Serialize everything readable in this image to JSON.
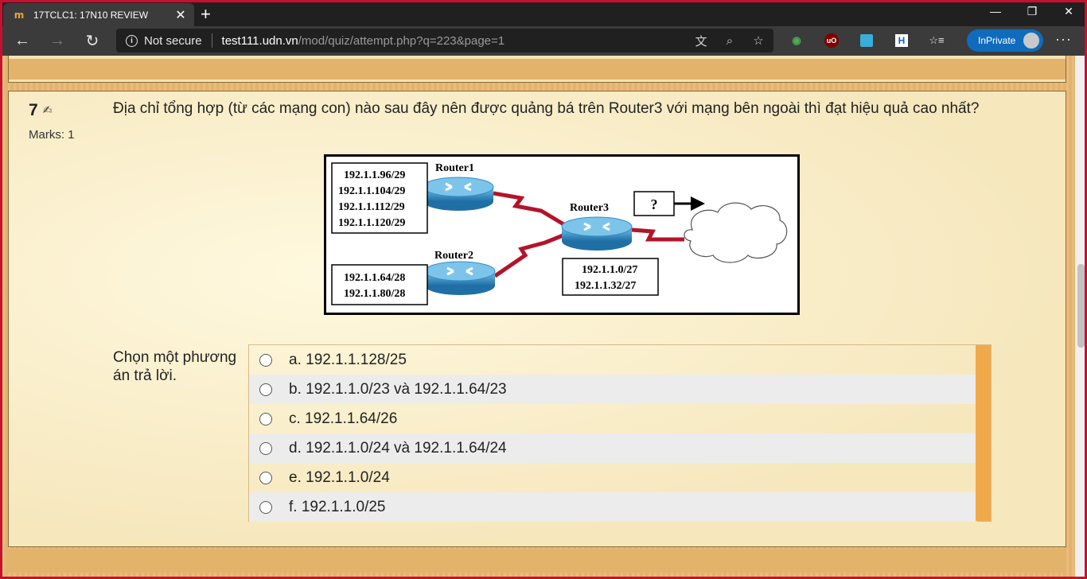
{
  "browser": {
    "tab_title": "17TCLC1: 17N10 REVIEW",
    "tab_favicon": "m",
    "not_secure": "Not secure",
    "url_host": "test111.udn.vn",
    "url_path": "/mod/quiz/attempt.php?q=223&page=1",
    "inprivate_label": "InPrivate"
  },
  "question": {
    "number": "7",
    "marks": "Marks: 1",
    "text": "Địa chỉ tổng hợp (từ các mạng con) nào sau đây nên được quảng bá trên Router3 với mạng bên ngoài thì đạt hiệu quả cao nhất?",
    "prompt": "Chọn một phương án trả lời."
  },
  "diagram": {
    "router1_label": "Router1",
    "router2_label": "Router2",
    "router3_label": "Router3",
    "unknown_label": "?",
    "router1_nets": [
      "192.1.1.96/29",
      "192.1.1.104/29",
      "192.1.1.112/29",
      "192.1.1.120/29"
    ],
    "router2_nets": [
      "192.1.1.64/28",
      "192.1.1.80/28"
    ],
    "router3_nets": [
      "192.1.1.0/27",
      "192.1.1.32/27"
    ]
  },
  "answers": [
    "a. 192.1.1.128/25",
    "b. 192.1.1.0/23 và 192.1.1.64/23",
    "c. 192.1.1.64/26",
    "d. 192.1.1.0/24 và 192.1.1.64/24",
    "e. 192.1.1.0/24",
    "f. 192.1.1.0/25"
  ],
  "colors": {
    "accent": "#f0a94a",
    "link_red": "#b3142a",
    "router_blue": "#2f8fc7"
  }
}
